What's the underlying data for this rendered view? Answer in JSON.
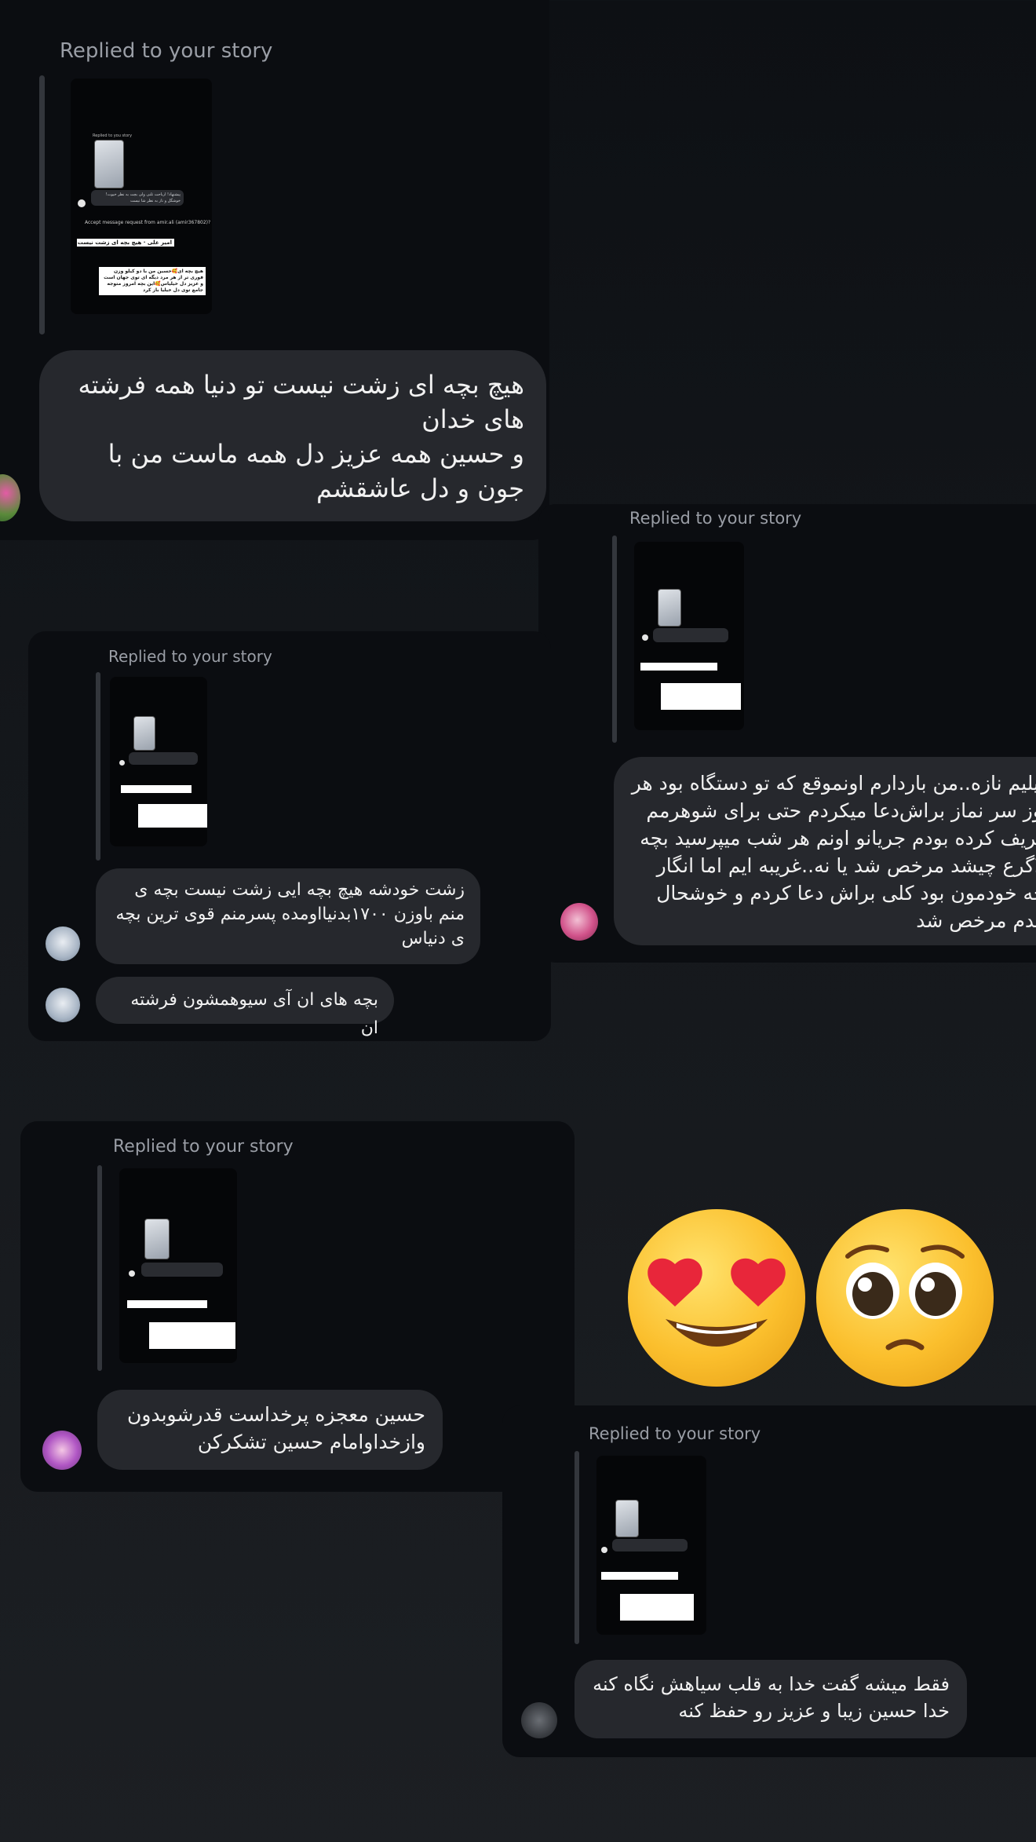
{
  "replied_label": "Replied to your story",
  "story_preview": {
    "mini_title": "Replied to you story",
    "mini_reply": "پیشنهاد! ارباحت تلنی ولی بچت به نظر خیوت! خوشگل و ناز به نظر شا نیست",
    "mini_accept": "Accept message request from amir.ali (amir367802)?",
    "mini_quote": "امیر علی · هیچ بچه ای زشت نیست",
    "mini_note": "هیچ بچه ای🥰حسین من با دو کیلو وزن فوری تر از هر مرد دیگه ای توی جهان است و عزیز دل خیلیاس🥰این بچه امروز متوجه جامع توی دل خیلیا باز کرد"
  },
  "messages": [
    {
      "id": 1,
      "text": "هیچ بچه ای زشت نیست تو دنیا همه فرشته های خدان\nو حسین همه عزیز دل همه ماست من با جون و دل عاشقشم"
    },
    {
      "id": 2,
      "text": "خیلیم نازه..من باردارم اونموقع که تو دستگاه بود هر روز سر نماز براش‌دعا میکردم حتی برای شوهرمم تعریف کرده بودم جریانو اونم هر شب میپرسید بچه بلاگرع چیشد مرخص شد یا نه..غریبه ایم اما انگار بچه خودمون بود کلی براش دعا کردم و خوشحال شدم مرخص شد"
    },
    {
      "id": 3,
      "text": "زشت خودشه  هیچ بچه ایی زشت نیست بچه ی منم باوزن ۱۷۰۰بدنیااومده  پسرمنم قوی ترین بچه ی دنیاس"
    },
    {
      "id": 4,
      "text": "بچه های ان آی سیوهمشون فرشته ان"
    },
    {
      "id": 5,
      "text": "حسین معجزه پرخداست قدرشوبدون وازخداوامام حسین تشکرکن"
    },
    {
      "id": 6,
      "text": "فقط میشه گفت خدا به قلب سیاهش نگاه کنه خدا حسین زیبا و عزیز رو حفظ کنه"
    }
  ],
  "reactions": [
    {
      "name": "heart-eyes",
      "glyph": "😍"
    },
    {
      "name": "pleading-face",
      "glyph": "🥺"
    }
  ],
  "colors": {
    "background": "#15181c",
    "card": "#0b0d11",
    "bubble": "#26282d",
    "text": "#f1f1f1",
    "secondary_text": "#9a9ea6"
  }
}
